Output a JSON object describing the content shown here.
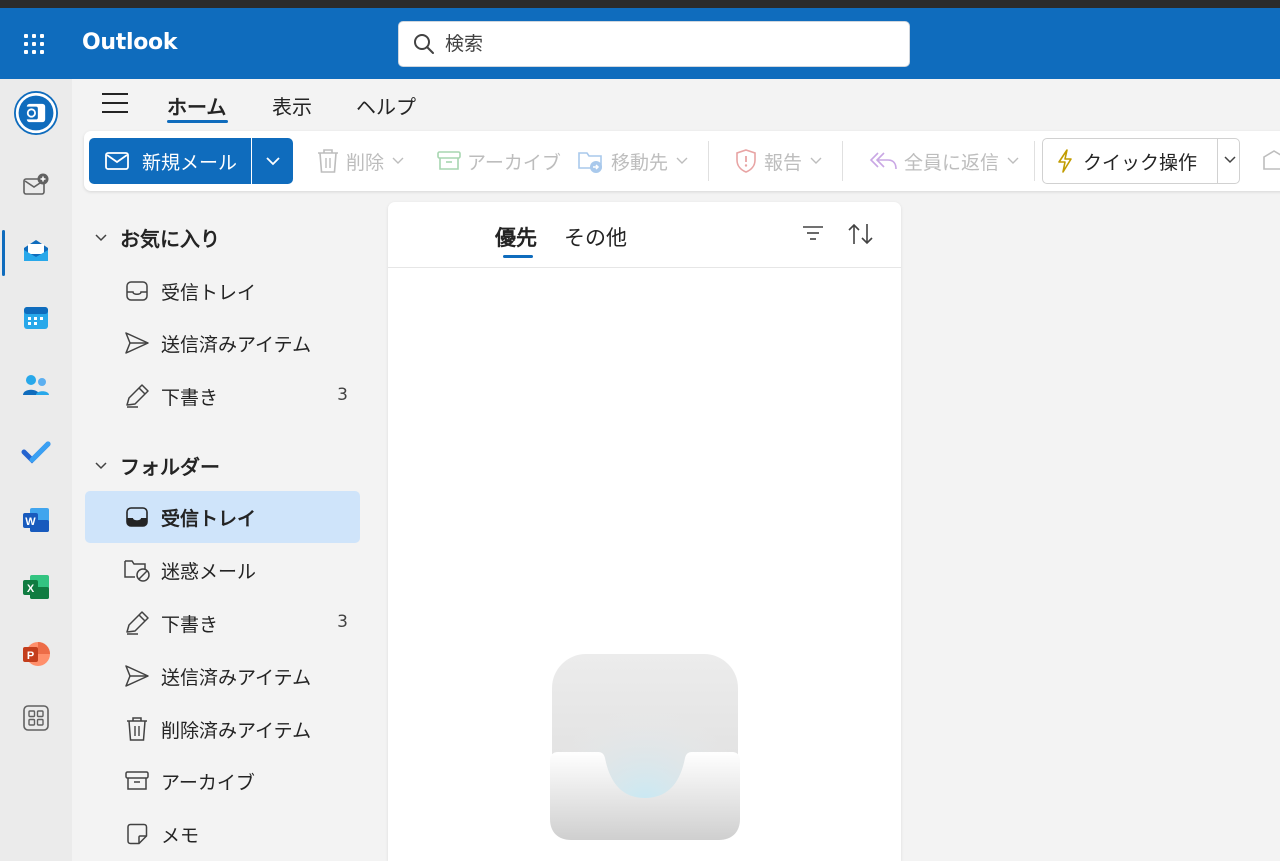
{
  "header": {
    "app_title": "Outlook",
    "search_placeholder": "検索"
  },
  "rail": {
    "items": [
      "outlook-logo",
      "new-mail-add",
      "mail",
      "calendar",
      "people",
      "to-do",
      "word",
      "excel",
      "powerpoint",
      "more-apps"
    ],
    "active": "mail"
  },
  "ribbon": {
    "tabs": [
      "ホーム",
      "表示",
      "ヘルプ"
    ],
    "active_tab": "ホーム"
  },
  "toolbar": {
    "new_mail": "新規メール",
    "delete": "削除",
    "archive": "アーカイブ",
    "move_to": "移動先",
    "report": "報告",
    "reply_all": "全員に返信",
    "quick_steps": "クイック操作"
  },
  "folders": {
    "favorites_title": "お気に入り",
    "favorites": [
      {
        "label": "受信トレイ",
        "count": ""
      },
      {
        "label": "送信済みアイテム",
        "count": ""
      },
      {
        "label": "下書き",
        "count": "3"
      }
    ],
    "folders_title": "フォルダー",
    "items": [
      {
        "label": "受信トレイ",
        "count": "",
        "selected": true
      },
      {
        "label": "迷惑メール",
        "count": ""
      },
      {
        "label": "下書き",
        "count": "3"
      },
      {
        "label": "送信済みアイテム",
        "count": ""
      },
      {
        "label": "削除済みアイテム",
        "count": ""
      },
      {
        "label": "アーカイブ",
        "count": ""
      },
      {
        "label": "メモ",
        "count": ""
      }
    ]
  },
  "message_list": {
    "tabs": [
      "優先",
      "その他"
    ],
    "active_tab": "優先"
  },
  "colors": {
    "brand": "#0f6cbd",
    "selected_bg": "#cfe4fa",
    "disabled_text": "#bdbdbd"
  }
}
